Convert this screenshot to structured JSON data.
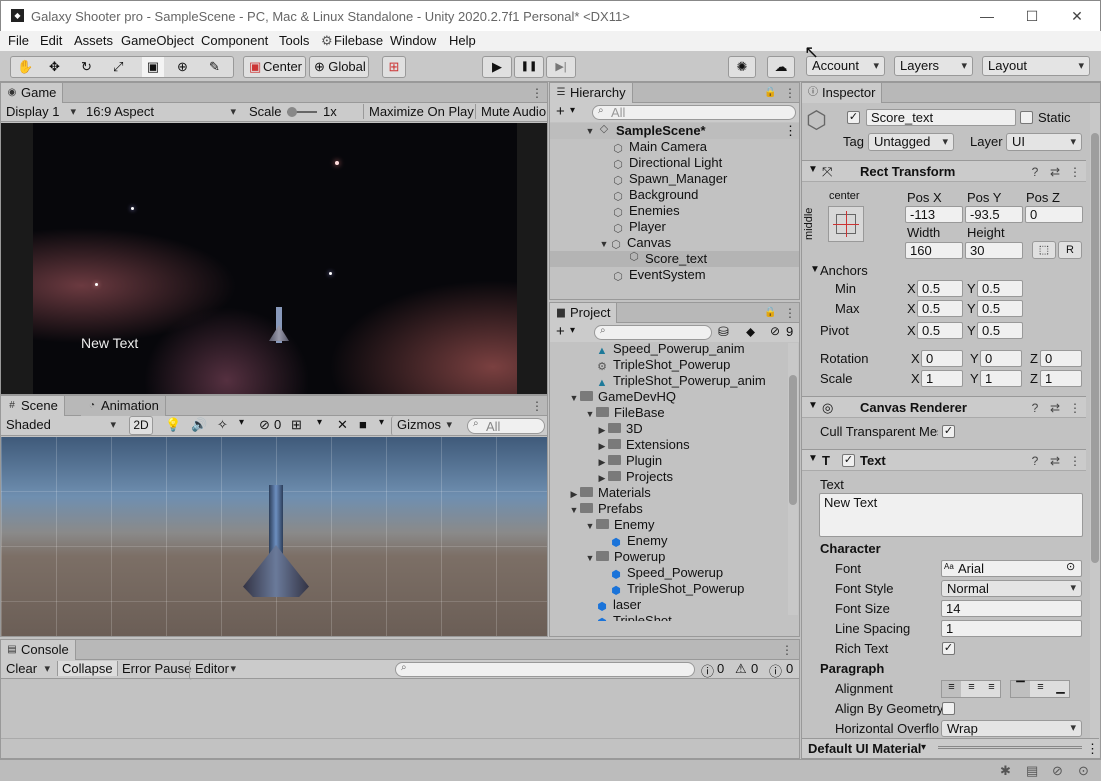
{
  "window": {
    "title": "Galaxy Shooter pro - SampleScene - PC, Mac & Linux Standalone - Unity 2020.2.7f1 Personal* <DX11>",
    "minimize": "—",
    "maximize": "☐",
    "close": "✕"
  },
  "menu": [
    "File",
    "Edit",
    "Assets",
    "GameObject",
    "Component",
    "Tools",
    "Filebase",
    "Window",
    "Help"
  ],
  "toolbar": {
    "center": "Center",
    "global": "Global",
    "play_icon": "▶",
    "pause_icon": "❚❚",
    "step_icon": "▶|",
    "account": "Account",
    "layers": "Layers",
    "layout": "Layout"
  },
  "game": {
    "tab": "Game",
    "display": "Display 1",
    "aspect": "16:9 Aspect",
    "scale_label": "Scale",
    "scale_value": "1x",
    "maximize": "Maximize On Play",
    "mute": "Mute Audio",
    "overlay_text": "New Text"
  },
  "scene": {
    "tab": "Scene",
    "tab2": "Animation",
    "shading": "Shaded",
    "mode2d": "2D",
    "hidden_count": "0",
    "gizmos": "Gizmos",
    "search_placeholder": "All"
  },
  "hierarchy": {
    "tab": "Hierarchy",
    "search_placeholder": "All",
    "scene": "SampleScene*",
    "items": [
      "Main Camera",
      "Directional Light",
      "Spawn_Manager",
      "Background",
      "Enemies",
      "Player",
      "Canvas",
      "Score_text",
      "EventSystem"
    ]
  },
  "project": {
    "tab": "Project",
    "hidden_count": "9",
    "items": [
      "Speed_Powerup_anim",
      "TripleShot_Powerup",
      "TripleShot_Powerup_anim",
      "GameDevHQ",
      "FileBase",
      "3D",
      "Extensions",
      "Plugin",
      "Projects",
      "Materials",
      "Prefabs",
      "Enemy",
      "Enemy",
      "Powerup",
      "Speed_Powerup",
      "TripleShot_Powerup",
      "laser",
      "TripleShot"
    ]
  },
  "console": {
    "tab": "Console",
    "clear": "Clear",
    "collapse": "Collapse",
    "error_pause": "Error Pause",
    "editor": "Editor",
    "log_count": "0",
    "warn_count": "0",
    "error_count": "0"
  },
  "inspector": {
    "tab": "Inspector",
    "name": "Score_text",
    "static": "Static",
    "tag_label": "Tag",
    "tag": "Untagged",
    "layer_label": "Layer",
    "layer": "UI",
    "rect": {
      "title": "Rect Transform",
      "anchor_h": "center",
      "anchor_v": "middle",
      "posx_label": "Pos X",
      "posy_label": "Pos Y",
      "posz_label": "Pos Z",
      "posx": "-113",
      "posy": "-93.5",
      "posz": "0",
      "width_label": "Width",
      "height_label": "Height",
      "width": "160",
      "height": "30",
      "r_btn": "R",
      "anchors": "Anchors",
      "min": "Min",
      "max": "Max",
      "pivot": "Pivot",
      "x": "X",
      "y": "Y",
      "z": "Z",
      "min_x": "0.5",
      "min_y": "0.5",
      "max_x": "0.5",
      "max_y": "0.5",
      "pivot_x": "0.5",
      "pivot_y": "0.5",
      "rotation": "Rotation",
      "scale": "Scale",
      "rot_x": "0",
      "rot_y": "0",
      "rot_z": "0",
      "scale_x": "1",
      "scale_y": "1",
      "scale_z": "1"
    },
    "canvas_renderer": {
      "title": "Canvas Renderer",
      "cull": "Cull Transparent Mes"
    },
    "text": {
      "title": "Text",
      "text_label": "Text",
      "text_value": "New Text",
      "character": "Character",
      "font_label": "Font",
      "font": "Arial",
      "font_style_label": "Font Style",
      "font_style": "Normal",
      "font_size_label": "Font Size",
      "font_size": "14",
      "line_spacing_label": "Line Spacing",
      "line_spacing": "1",
      "rich_text_label": "Rich Text",
      "paragraph": "Paragraph",
      "alignment_label": "Alignment",
      "align_geom_label": "Align By Geometry",
      "hoverflow_label": "Horizontal Overflo",
      "hoverflow": "Wrap"
    },
    "material": "Default UI Material"
  },
  "colors": {
    "accent": "#1a73d9",
    "panel": "#c2c2c2",
    "tab_active": "#cbcbcb",
    "selection": "#b4b4b4"
  }
}
